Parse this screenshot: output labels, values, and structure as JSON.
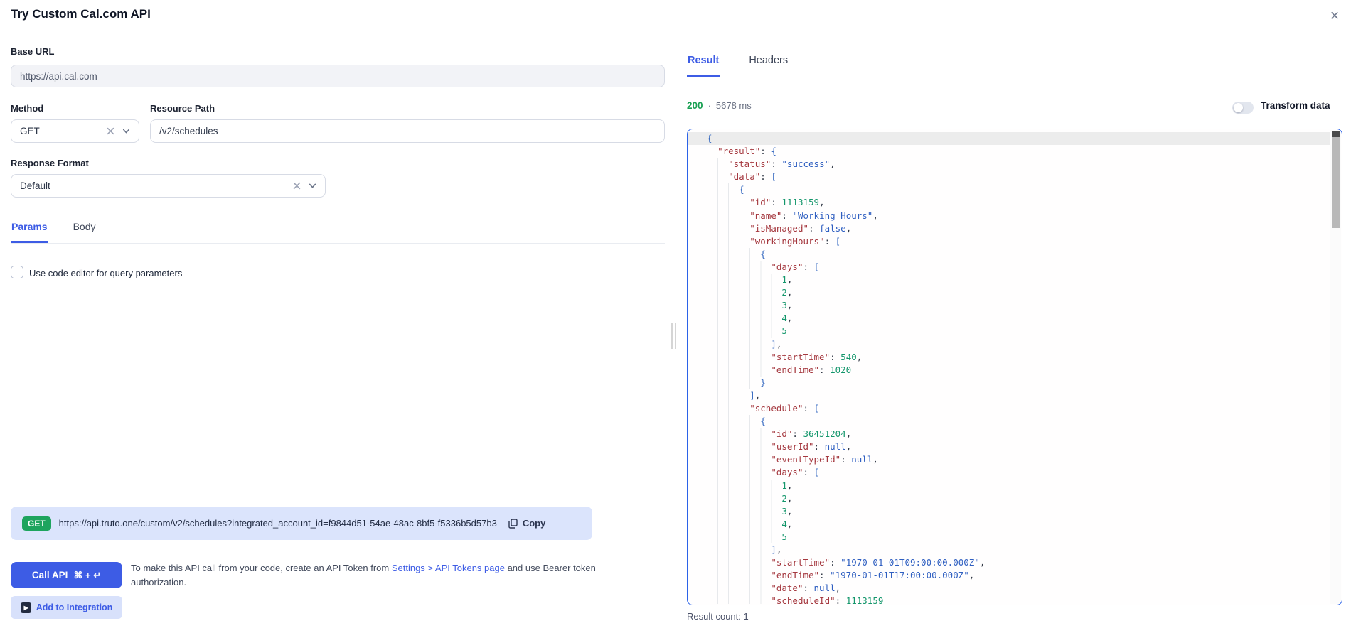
{
  "colors": {
    "accent_blue": "#3d5ce5",
    "success_green": "#18a052",
    "badge_green": "#1ea45e",
    "preview_bar_bg": "#dbe4fc",
    "code_border_blue": "#2b63e8",
    "code_key": "#a5383f",
    "code_string": "#2f5fc1",
    "code_number": "#13966b"
  },
  "icons": {
    "close": "✕",
    "clear": "✕",
    "chevron_down": "⌄",
    "copy": "copy-icon (two squares)",
    "play": "▶"
  },
  "window": {
    "title": "Try Custom Cal.com API"
  },
  "request": {
    "base_url": {
      "label": "Base URL",
      "value": "https://api.cal.com"
    },
    "method": {
      "label": "Method",
      "value": "GET"
    },
    "resource_path": {
      "label": "Resource Path",
      "value": "/v2/schedules"
    },
    "response_format": {
      "label": "Response Format",
      "value": "Default"
    },
    "tabs": {
      "params": "Params",
      "body": "Body"
    },
    "code_editor_checkbox_label": "Use code editor for query parameters"
  },
  "request_preview": {
    "method_badge": "GET",
    "url": "https://api.truto.one/custom/v2/schedules?integrated_account_id=f9844d51-54ae-48ac-8bf5-f5336b5d57b3",
    "copy_label": "Copy"
  },
  "actions": {
    "call_api_label": "Call API",
    "call_api_shortcut": "⌘ + ↵",
    "token_hint_before": "To make this API call from your code, create an API Token from ",
    "token_hint_link": "Settings > API Tokens page",
    "token_hint_after": " and use Bearer token authorization.",
    "add_to_integration_label": "Add to Integration",
    "play_glyph": "▶"
  },
  "response": {
    "tabs": {
      "result": "Result",
      "headers": "Headers"
    },
    "status_code": "200",
    "status_separator": "·",
    "duration": "5678 ms",
    "transform_toggle_label": "Transform data",
    "result_count": "Result count: 1",
    "body_lines": [
      "{",
      "  \"result\": {",
      "    \"status\": \"success\",",
      "    \"data\": [",
      "      {",
      "        \"id\": 1113159,",
      "        \"name\": \"Working Hours\",",
      "        \"isManaged\": false,",
      "        \"workingHours\": [",
      "          {",
      "            \"days\": [",
      "              1,",
      "              2,",
      "              3,",
      "              4,",
      "              5",
      "            ],",
      "            \"startTime\": 540,",
      "            \"endTime\": 1020",
      "          }",
      "        ],",
      "        \"schedule\": [",
      "          {",
      "            \"id\": 36451204,",
      "            \"userId\": null,",
      "            \"eventTypeId\": null,",
      "            \"days\": [",
      "              1,",
      "              2,",
      "              3,",
      "              4,",
      "              5",
      "            ],",
      "            \"startTime\": \"1970-01-01T09:00:00.000Z\",",
      "            \"endTime\": \"1970-01-01T17:00:00.000Z\",",
      "            \"date\": null,",
      "            \"scheduleId\": 1113159"
    ]
  }
}
